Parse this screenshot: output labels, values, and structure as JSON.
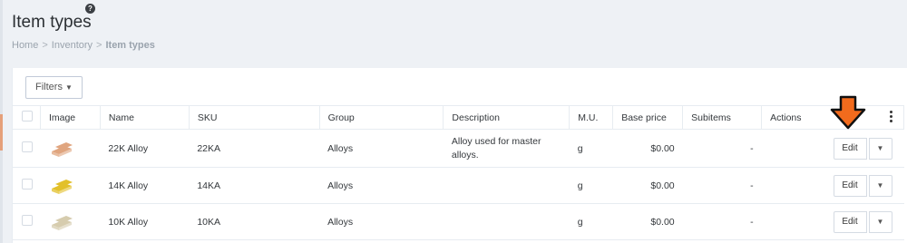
{
  "page": {
    "title": "Item types",
    "help_icon": "?"
  },
  "breadcrumb": {
    "items": [
      "Home",
      "Inventory",
      "Item types"
    ],
    "separator": ">"
  },
  "toolbar": {
    "filters_label": "Filters",
    "filters_caret": "▼"
  },
  "table": {
    "columns": [
      "Image",
      "Name",
      "SKU",
      "Group",
      "Description",
      "M.U.",
      "Base price",
      "Subitems",
      "Actions"
    ],
    "rows": [
      {
        "name": "22K Alloy",
        "sku": "22KA",
        "group": "Alloys",
        "description": "Alloy used for master alloys.",
        "mu": "g",
        "base_price": "$0.00",
        "subitems": "-",
        "edit_label": "Edit",
        "dropdown": "▼",
        "image_color": "#e0a57f"
      },
      {
        "name": "14K Alloy",
        "sku": "14KA",
        "group": "Alloys",
        "description": "",
        "mu": "g",
        "base_price": "$0.00",
        "subitems": "-",
        "edit_label": "Edit",
        "dropdown": "▼",
        "image_color": "#e2c02a"
      },
      {
        "name": "10K Alloy",
        "sku": "10KA",
        "group": "Alloys",
        "description": "",
        "mu": "g",
        "base_price": "$0.00",
        "subitems": "-",
        "edit_label": "Edit",
        "dropdown": "▼",
        "image_color": "#d6ccae"
      }
    ]
  },
  "colors": {
    "background": "#eef1f5",
    "panel": "#ffffff",
    "border": "#e7ecf1",
    "annotation_arrow": "#f26b1d"
  },
  "icons": {
    "help": "help-icon",
    "kebab": "kebab-menu-icon",
    "caret": "caret-down-icon",
    "annotation": "arrow-down-icon"
  }
}
